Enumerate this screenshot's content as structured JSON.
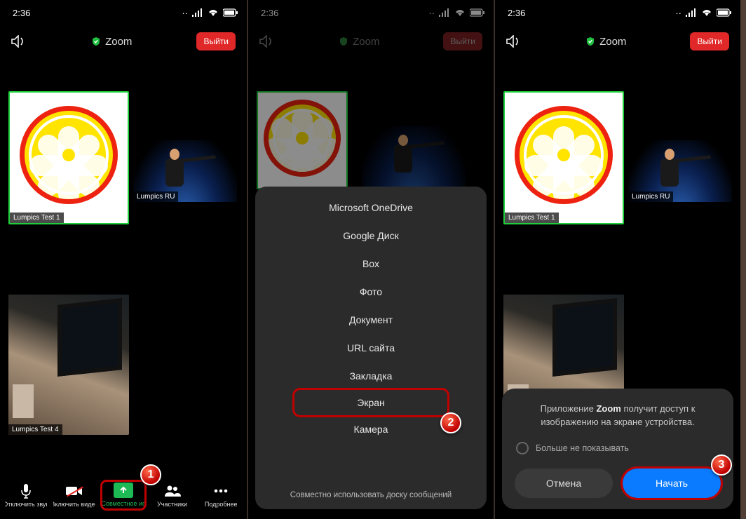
{
  "status_time": "2:36",
  "top": {
    "title": "Zoom",
    "leave": "Выйти"
  },
  "tiles": {
    "self": "Lumpics Test 1",
    "remote": "Lumpics RU",
    "cam": "Lumpics Test 4"
  },
  "bottombar": {
    "mute": "Отключить звук",
    "video": "Включить видео",
    "share": "Совместное ис",
    "participants": "Участники",
    "more": "Подробнее"
  },
  "sheet": {
    "onedrive": "Microsoft OneDrive",
    "gdrive": "Google Диск",
    "box": "Box",
    "photo": "Фото",
    "doc": "Документ",
    "url": "URL сайта",
    "bookmark": "Закладка",
    "screen": "Экран",
    "camera": "Камера",
    "footer": "Совместно использовать доску сообщений"
  },
  "dialog": {
    "msg_pre": "Приложение ",
    "msg_app": "Zoom",
    "msg_post": " получит доступ к изображению на экране устройства.",
    "dont_show": "Больше не показывать",
    "cancel": "Отмена",
    "start": "Начать"
  },
  "badges": {
    "b1": "1",
    "b2": "2",
    "b3": "3"
  }
}
